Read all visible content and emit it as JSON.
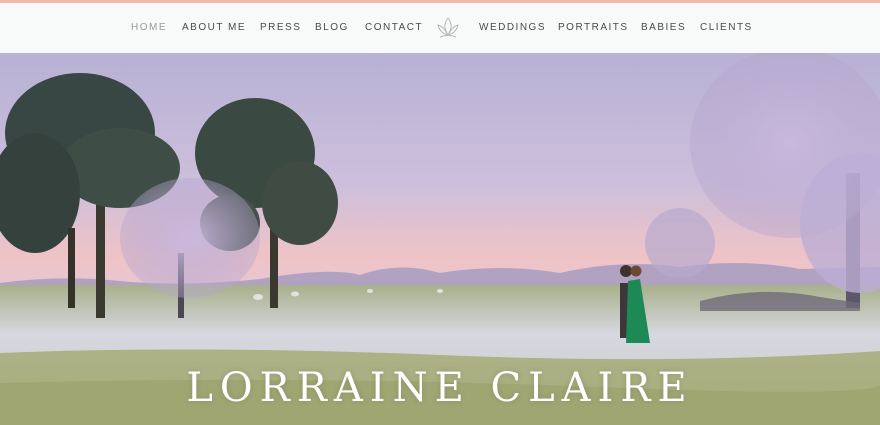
{
  "nav": {
    "items": [
      {
        "label": "HOME",
        "active": true
      },
      {
        "label": "ABOUT ME"
      },
      {
        "label": "PRESS"
      },
      {
        "label": "BLOG"
      },
      {
        "label": "CONTACT"
      },
      {
        "label": "WEDDINGS"
      },
      {
        "label": "PORTRAITS"
      },
      {
        "label": "BABIES"
      },
      {
        "label": "CLIENTS"
      }
    ],
    "logo_icon": "lotus-icon"
  },
  "hero": {
    "title": "LORRAINE CLAIRE",
    "colors": {
      "sky_top": "#b9b2d3",
      "sky_glow": "#f0c2c4",
      "grass": "#a9b082",
      "frost": "#d8d9df",
      "dress": "#1d8a55"
    }
  }
}
